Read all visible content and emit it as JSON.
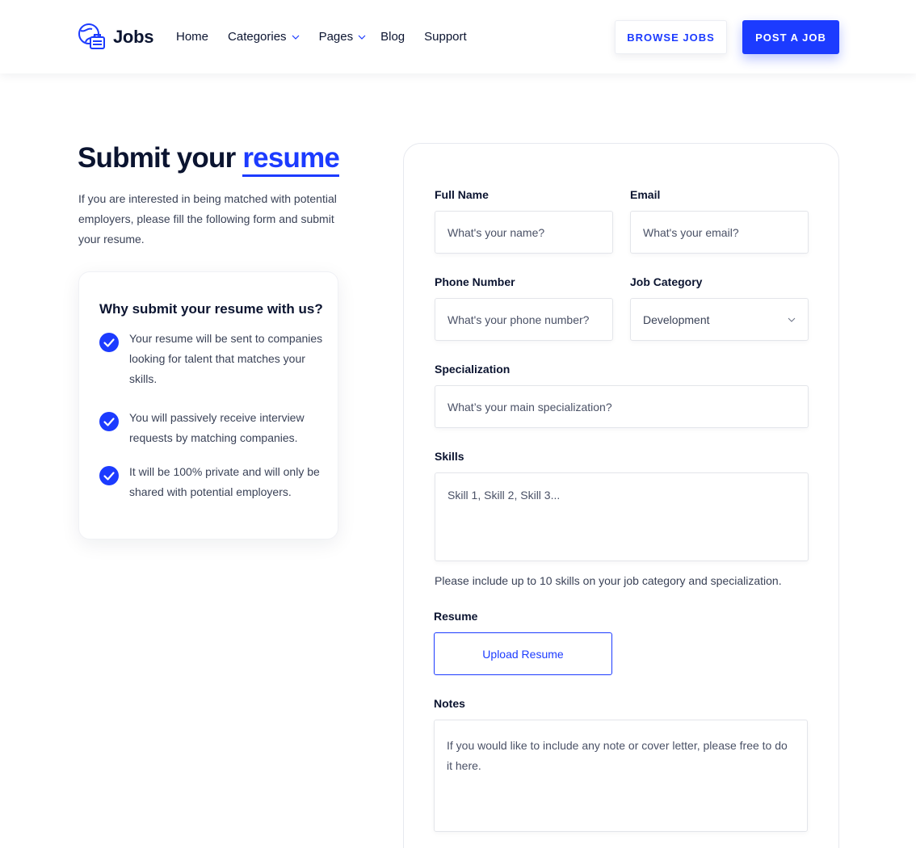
{
  "header": {
    "logo_text": "Jobs",
    "nav": {
      "home": "Home",
      "categories": "Categories",
      "pages": "Pages",
      "blog": "Blog",
      "support": "Support"
    },
    "browse_jobs": "BROWSE JOBS",
    "post_job": "POST A JOB"
  },
  "hero": {
    "title_part1": "Submit",
    "title_part2": "your",
    "title_accent": "resume",
    "intro": "If you are interested in being matched with potential employers, please fill the following form and submit your resume."
  },
  "why": {
    "title": "Why submit your resume with us?",
    "items": [
      "Your resume will be sent to companies looking for talent that matches your skills.",
      "You will passively receive interview requests by matching companies.",
      "It will be 100% private and will only be shared with potential employers."
    ]
  },
  "form": {
    "full_name": {
      "label": "Full Name",
      "placeholder": "What's your name?"
    },
    "email": {
      "label": "Email",
      "placeholder": "What's your email?"
    },
    "phone": {
      "label": "Phone Number",
      "placeholder": "What's your phone number?"
    },
    "job_category": {
      "label": "Job Category",
      "value": "Development"
    },
    "specialization": {
      "label": "Specialization",
      "placeholder": "What’s your main specialization?"
    },
    "skills": {
      "label": "Skills",
      "placeholder": "Skill 1, Skill 2, Skill 3...",
      "hint": "Please include up to 10 skills on your job category and specialization."
    },
    "resume": {
      "label": "Resume",
      "button": "Upload Resume"
    },
    "notes": {
      "label": "Notes",
      "placeholder": "If you would like to include any note or cover letter, please free to do it here."
    }
  },
  "colors": {
    "accent": "#1c3bff",
    "text": "#0b1430"
  }
}
